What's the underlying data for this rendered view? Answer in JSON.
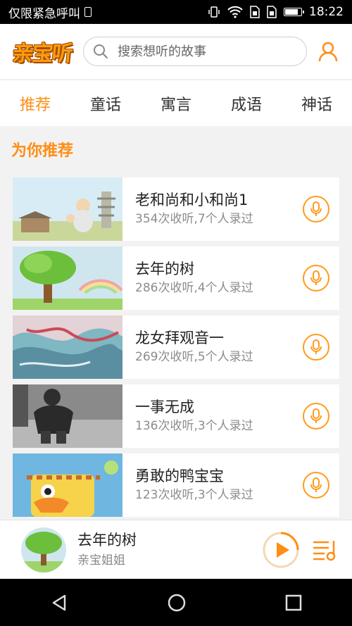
{
  "status_bar": {
    "carrier_text": "仅限紧急呼叫",
    "time": "18:22",
    "icons": [
      "sim-icon",
      "vibrate-icon",
      "wifi-icon",
      "sim1-icon",
      "sim2-icon",
      "battery-charging-icon"
    ]
  },
  "header": {
    "logo_text": "亲宝听",
    "search": {
      "placeholder": "搜索想听的故事",
      "value": ""
    },
    "user_icon": "user-icon"
  },
  "tabs": [
    {
      "label": "推荐",
      "active": true
    },
    {
      "label": "童话",
      "active": false
    },
    {
      "label": "寓言",
      "active": false
    },
    {
      "label": "成语",
      "active": false
    },
    {
      "label": "神话",
      "active": false
    }
  ],
  "section": {
    "title": "为你推荐"
  },
  "stories": [
    {
      "title": "老和尚和小和尚1",
      "meta": "354次收听,7个人录过"
    },
    {
      "title": "去年的树",
      "meta": "286次收听,4个人录过"
    },
    {
      "title": "龙女拜观音一",
      "meta": "269次收听,5个人录过"
    },
    {
      "title": "一事无成",
      "meta": "136次收听,3个人录过"
    },
    {
      "title": "勇敢的鸭宝宝",
      "meta": "123次收听,3个人录过"
    }
  ],
  "player": {
    "title": "去年的树",
    "subtitle": "亲宝姐姐",
    "progress": 0.25
  },
  "colors": {
    "accent": "#ff8d14",
    "header_bg": "#ffffff",
    "page_bg": "#f2f2f2"
  }
}
